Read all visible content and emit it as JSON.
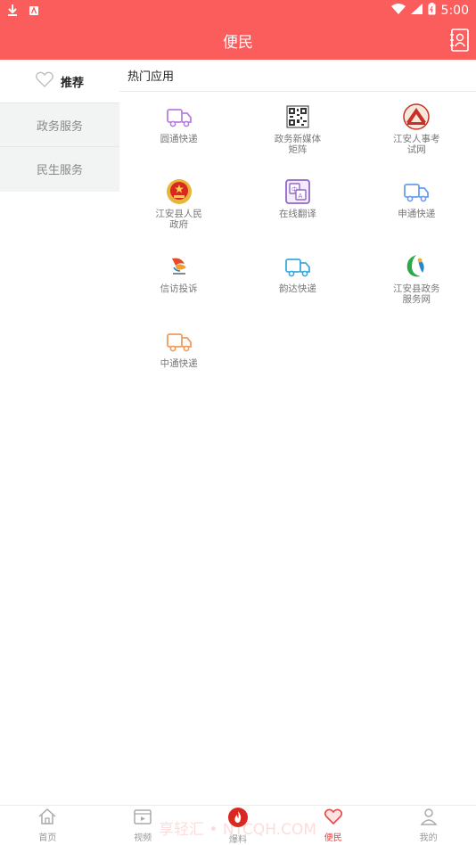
{
  "status_bar": {
    "time": "5:00",
    "icons": [
      "download-icon",
      "sim-icon",
      "wifi-icon",
      "signal-icon",
      "battery-icon"
    ]
  },
  "header": {
    "title": "便民",
    "action_icon": "contact-book-icon",
    "color": "#fb5d5d"
  },
  "sidebar": {
    "items": [
      {
        "label": "推荐",
        "icon": "heart-outline-icon",
        "active": true
      },
      {
        "label": "政务服务",
        "active": false
      },
      {
        "label": "民生服务",
        "active": false
      }
    ]
  },
  "main": {
    "section_title": "热门应用",
    "apps": [
      {
        "label": "圆通快递",
        "icon": "truck-icon",
        "color": "#b77ee0"
      },
      {
        "label": "政务新媒体矩阵",
        "icon": "qrcode-icon",
        "color": "#333333"
      },
      {
        "label": "江安人事考试网",
        "icon": "pta-logo-icon",
        "color": "#c8302a"
      },
      {
        "label": "江安县人民政府",
        "icon": "national-emblem-icon",
        "color": "#d8281f"
      },
      {
        "label": "在线翻译",
        "icon": "translate-icon",
        "color": "#9068c8"
      },
      {
        "label": "申通快递",
        "icon": "truck-icon",
        "color": "#6a9cf0"
      },
      {
        "label": "信访投诉",
        "icon": "petition-logo-icon",
        "color": "#e24b2c"
      },
      {
        "label": "韵达快递",
        "icon": "truck-icon",
        "color": "#3aa9e0"
      },
      {
        "label": "江安县政务服务网",
        "icon": "gov-service-logo-icon",
        "color": "#2aa84a"
      },
      {
        "label": "中通快递",
        "icon": "truck-icon",
        "color": "#f29a5c"
      }
    ]
  },
  "tab_bar": {
    "items": [
      {
        "label": "首页",
        "icon": "home-icon",
        "active": false
      },
      {
        "label": "视频",
        "icon": "video-icon",
        "active": false
      },
      {
        "label": "爆料",
        "icon": "fire-icon",
        "active": false
      },
      {
        "label": "便民",
        "icon": "heart-icon",
        "active": true
      },
      {
        "label": "我的",
        "icon": "user-icon",
        "active": false
      }
    ]
  },
  "watermark": "享轻汇 • NTCQH.COM"
}
